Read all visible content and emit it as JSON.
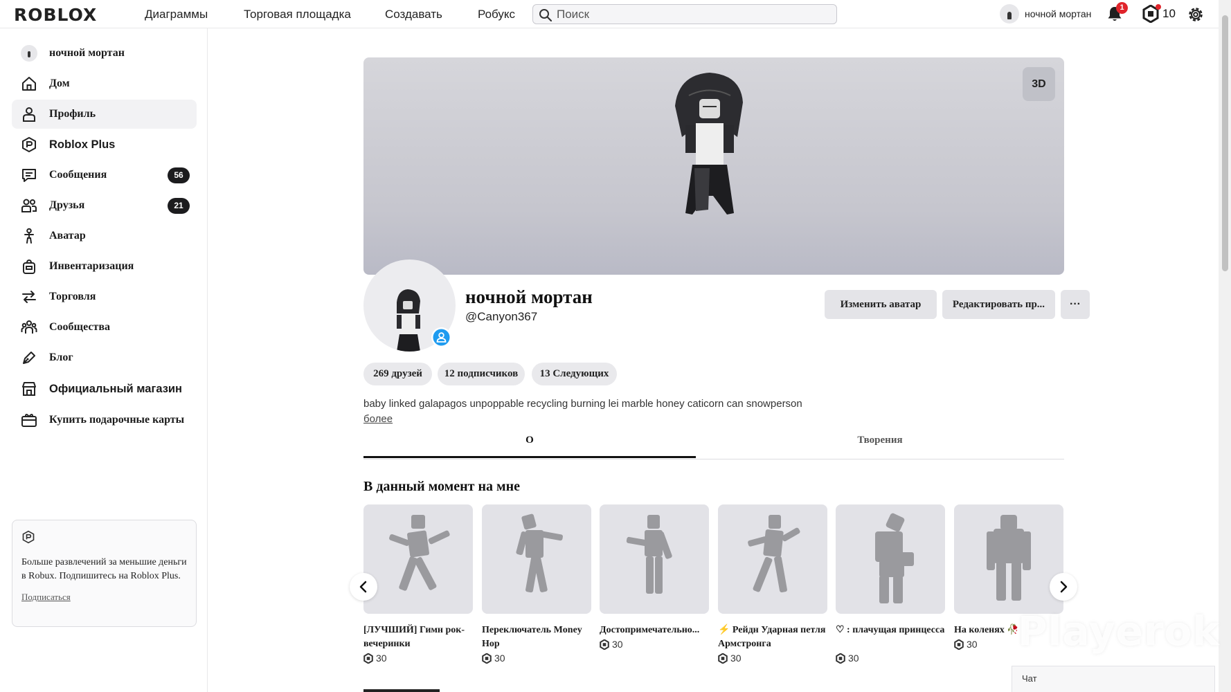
{
  "topbar": {
    "logo": "ROBLOX",
    "nav": [
      "Диаграммы",
      "Торговая площадка",
      "Создавать",
      "Робукс"
    ],
    "search_placeholder": "Поиск",
    "user_name": "ночной мортан",
    "notification_count": "1",
    "robux_balance": "10"
  },
  "sidebar": {
    "items": [
      {
        "label": "ночной мортан",
        "icon": "avatar-icon"
      },
      {
        "label": "Дом",
        "icon": "home-icon"
      },
      {
        "label": "Профиль",
        "icon": "profile-icon",
        "active": true
      },
      {
        "label": "Roblox Plus",
        "icon": "roblox-plus-icon"
      },
      {
        "label": "Сообщения",
        "icon": "messages-icon",
        "badge": "56"
      },
      {
        "label": "Друзья",
        "icon": "friends-icon",
        "badge": "21"
      },
      {
        "label": "Аватар",
        "icon": "avatar-editor-icon"
      },
      {
        "label": "Инвентаризация",
        "icon": "inventory-icon"
      },
      {
        "label": "Торговля",
        "icon": "trade-icon"
      },
      {
        "label": "Сообщества",
        "icon": "communities-icon"
      },
      {
        "label": "Блог",
        "icon": "blog-icon"
      },
      {
        "label": "Официальный магазин",
        "icon": "store-icon"
      },
      {
        "label": "Купить подарочные карты",
        "icon": "gift-card-icon"
      }
    ],
    "promo": {
      "text": "Больше развлечений за меньшие деньги в Robux. Подпишитесь на Roblox Plus.",
      "link": "Подписаться"
    }
  },
  "profile": {
    "display_name": "ночной мортан",
    "username": "@Canyon367",
    "btn_3d": "3D",
    "btn_change_avatar": "Изменить аватар",
    "btn_edit_profile": "Редактировать пр...",
    "btn_more": "···",
    "stats": [
      "269 друзей",
      "12 подписчиков",
      "13 Следующих"
    ],
    "bio": "baby linked galapagos unpoppable recycling burning lei marble honey caticorn can snowperson",
    "bio_more": "более",
    "tabs": [
      "О",
      "Творения"
    ]
  },
  "wearing": {
    "title": "В данный момент на мне",
    "items": [
      {
        "name": "[ЛУЧШИЙ] Гимн рок-вечеринки",
        "price": "30"
      },
      {
        "name": "Переключатель Money Hop",
        "price": "30"
      },
      {
        "name": "Достопримечательно...",
        "price": "30"
      },
      {
        "name": "⚡ Рейдн Ударная петля Армстронга",
        "price": "30"
      },
      {
        "name": "♡ : плачущая принцесса",
        "price": "30"
      },
      {
        "name": "На коленях 🥀",
        "price": "30"
      }
    ]
  },
  "overlay": {
    "watermark": "Playerok",
    "chat": "Чат"
  },
  "colors": {
    "accent_badge": "#e0242b",
    "online_blue": "#1e9bf0",
    "card_bg": "#e2e2e7"
  }
}
